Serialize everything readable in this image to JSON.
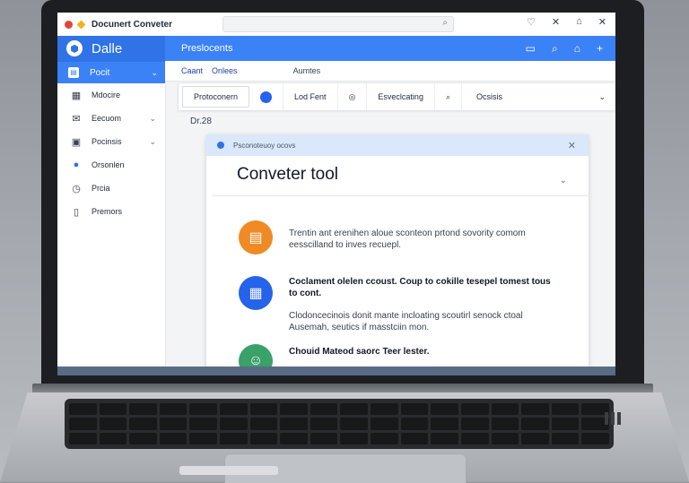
{
  "window": {
    "title": "Docunert Conveter",
    "search_icon": "search-icon"
  },
  "window_controls": [
    "heart-icon",
    "close-icon",
    "home-icon",
    "close-icon"
  ],
  "brand": {
    "name": "Dalle"
  },
  "sidebar": {
    "top": {
      "label": "Pocit"
    },
    "items": [
      {
        "label": "Mdocire",
        "icon": "building-icon"
      },
      {
        "label": "Eecuom",
        "icon": "mail-icon",
        "chevron": true
      },
      {
        "label": "Pocinsis",
        "icon": "image-icon",
        "chevron": true
      },
      {
        "label": "Orsonlen",
        "icon": "check-circle-icon"
      },
      {
        "label": "Prcia",
        "icon": "clock-icon"
      },
      {
        "label": "Premors",
        "icon": "bookmark-icon"
      }
    ]
  },
  "header": {
    "label": "Preslocents"
  },
  "tabs": {
    "t1": "Caant",
    "t2": "Onlees",
    "t3": "Aumtes"
  },
  "toolbar": {
    "b1": "Protoconern",
    "b2": "Lod Fent",
    "b3": "Esveclcating",
    "b4": "Ocsisis"
  },
  "date": "Dr.28",
  "panel": {
    "header": "Psconoteuoy ocovs",
    "title": "Conveter tool",
    "features": [
      {
        "icon": "document-icon",
        "color": "#f08a24",
        "text": "Trentin ant erenihen aloue sconteon prtond sovority comom eesscilland to inves recuepl."
      },
      {
        "icon": "calendar-icon",
        "color": "#2563eb",
        "title": "Coclament olelen ccoust. Coup to cokille tesepel tomest tous to cont.",
        "text": "Clodoncecinois donit mante incloating scoutirl senock ctoal Ausemah, seutics if masstciin mon."
      },
      {
        "icon": "user-icon",
        "color": "#3aa169",
        "title": "Chouid Mateod saorc Teer lester."
      }
    ]
  }
}
